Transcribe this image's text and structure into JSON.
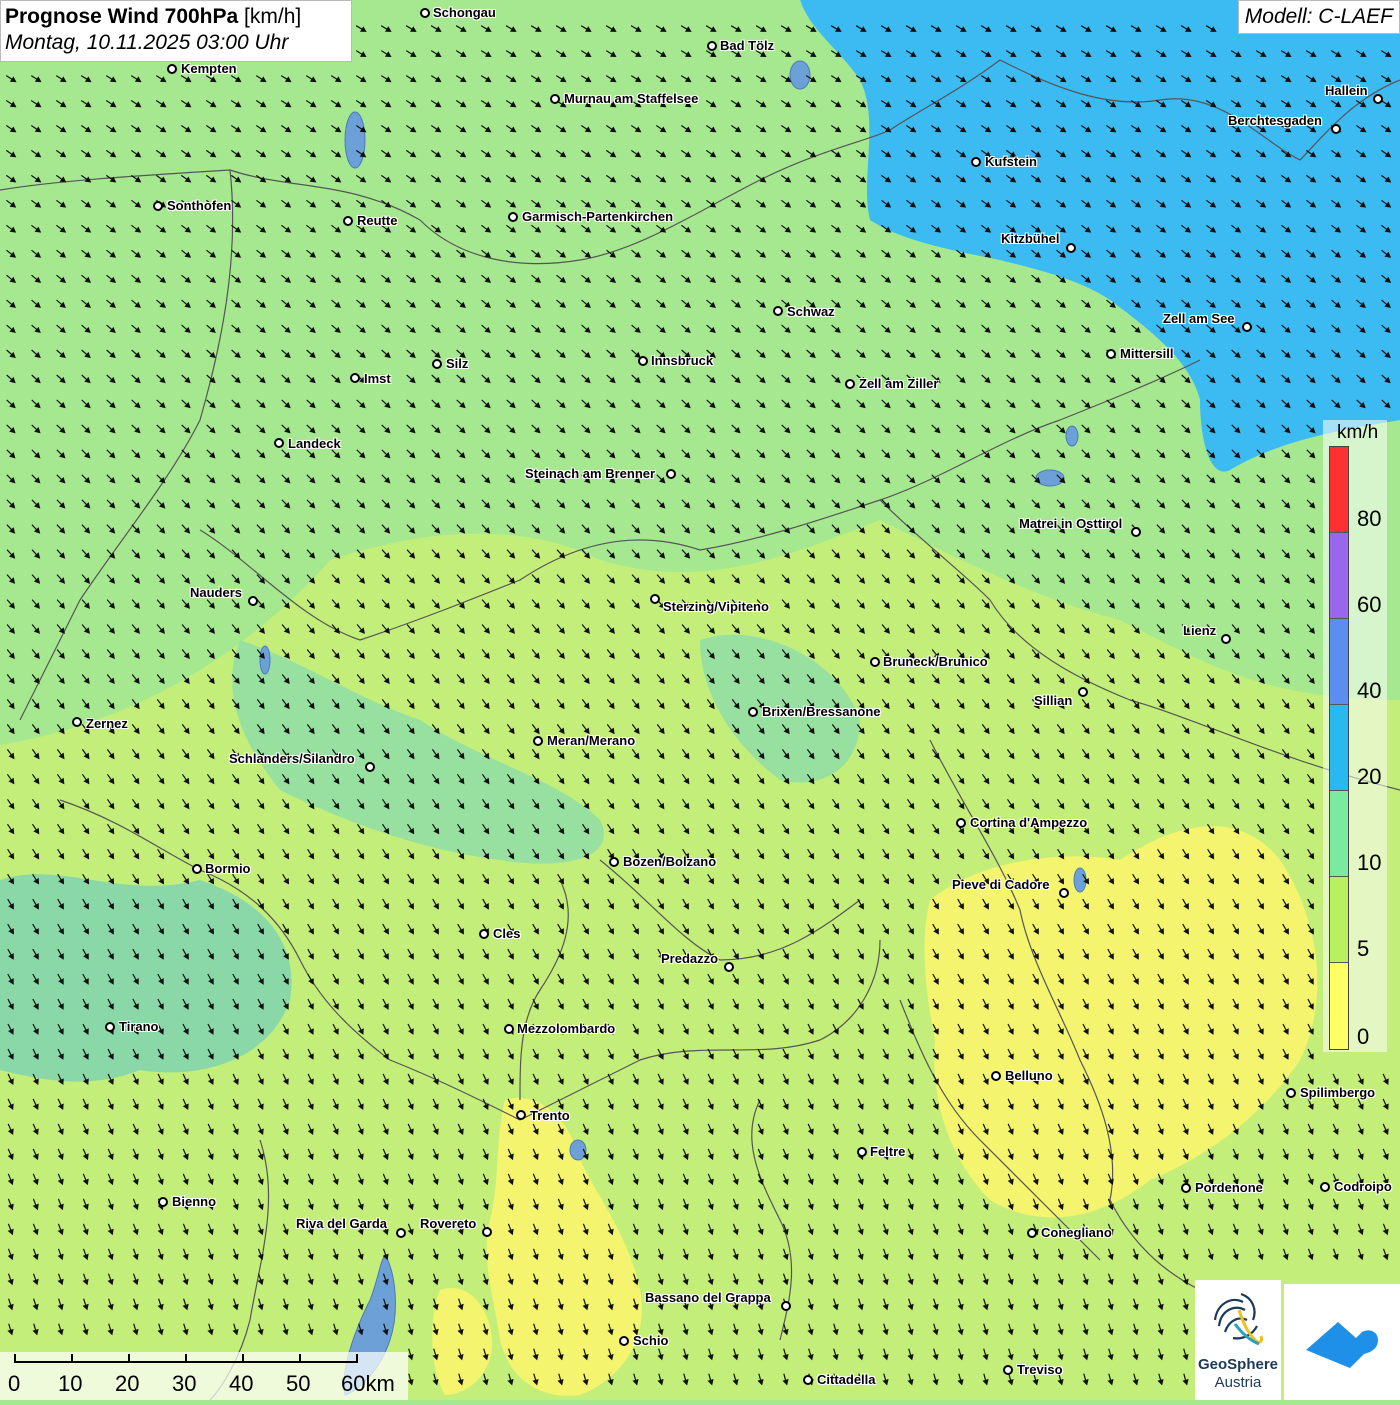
{
  "title": {
    "parameter": "Prognose Wind 700hPa",
    "unit": "[km/h]",
    "datetime": "Montag, 10.11.2025 03:00 Uhr"
  },
  "model_label": "Modell: C-LAEF",
  "legend": {
    "unit": "km/h",
    "ticks": [
      "80",
      "60",
      "40",
      "20",
      "10",
      "5",
      "0"
    ],
    "colors": [
      "#ff3030",
      "#9966ee",
      "#5b8ef0",
      "#2ab8f0",
      "#7aeaa0",
      "#b8f060",
      "#ffff66"
    ]
  },
  "colors": {
    "fill_0_5": "#f4f46e",
    "fill_5_10": "#c4ee7a",
    "fill_10_20": "#9ee692",
    "fill_20_40": "#3cbaf2",
    "fill_teal": "#8ad8a8",
    "border": "#555555",
    "lake": "#6ea0d8"
  },
  "scalebar": {
    "labels": [
      "0",
      "10",
      "20",
      "30",
      "40",
      "50",
      "60km"
    ]
  },
  "logos": {
    "geosphere_line1": "GeoSphere",
    "geosphere_line2": "Austria"
  },
  "places": [
    {
      "name": "Schongau"
    },
    {
      "name": "Bad Tölz"
    },
    {
      "name": "Kempten"
    },
    {
      "name": "Murnau am Staffelsee"
    },
    {
      "name": "Hallein"
    },
    {
      "name": "Berchtesgaden"
    },
    {
      "name": "Kufstein"
    },
    {
      "name": "Sonthofen"
    },
    {
      "name": "Reutte"
    },
    {
      "name": "Garmisch-Partenkirchen"
    },
    {
      "name": "Kitzbühel"
    },
    {
      "name": "Schwaz"
    },
    {
      "name": "Zell am See"
    },
    {
      "name": "Innsbruck"
    },
    {
      "name": "Mittersill"
    },
    {
      "name": "Silz"
    },
    {
      "name": "Imst"
    },
    {
      "name": "Zell am Ziller"
    },
    {
      "name": "Landeck"
    },
    {
      "name": "Steinach am Brenner"
    },
    {
      "name": "Matrei in Osttirol"
    },
    {
      "name": "Nauders"
    },
    {
      "name": "Sterzing/Vipiteno"
    },
    {
      "name": "Lienz"
    },
    {
      "name": "Bruneck/Brunico"
    },
    {
      "name": "Sillian"
    },
    {
      "name": "Brixen/Bressanone"
    },
    {
      "name": "Zernez"
    },
    {
      "name": "Meran/Merano"
    },
    {
      "name": "Schlanders/Silandro"
    },
    {
      "name": "Cortina d'Ampezzo"
    },
    {
      "name": "Bozen/Bolzano"
    },
    {
      "name": "Bormio"
    },
    {
      "name": "Pieve di Cadore"
    },
    {
      "name": "Cles"
    },
    {
      "name": "Predazzo"
    },
    {
      "name": "Tirano"
    },
    {
      "name": "Mezzolombardo"
    },
    {
      "name": "Belluno"
    },
    {
      "name": "Spilimbergo"
    },
    {
      "name": "Trento"
    },
    {
      "name": "Feltre"
    },
    {
      "name": "Pordenone"
    },
    {
      "name": "Codroipo"
    },
    {
      "name": "Bienno"
    },
    {
      "name": "Riva del Garda"
    },
    {
      "name": "Rovereto"
    },
    {
      "name": "Conegliano"
    },
    {
      "name": "Bassano del Grappa"
    },
    {
      "name": "Schio"
    },
    {
      "name": "Treviso"
    },
    {
      "name": "Cittadella"
    }
  ]
}
